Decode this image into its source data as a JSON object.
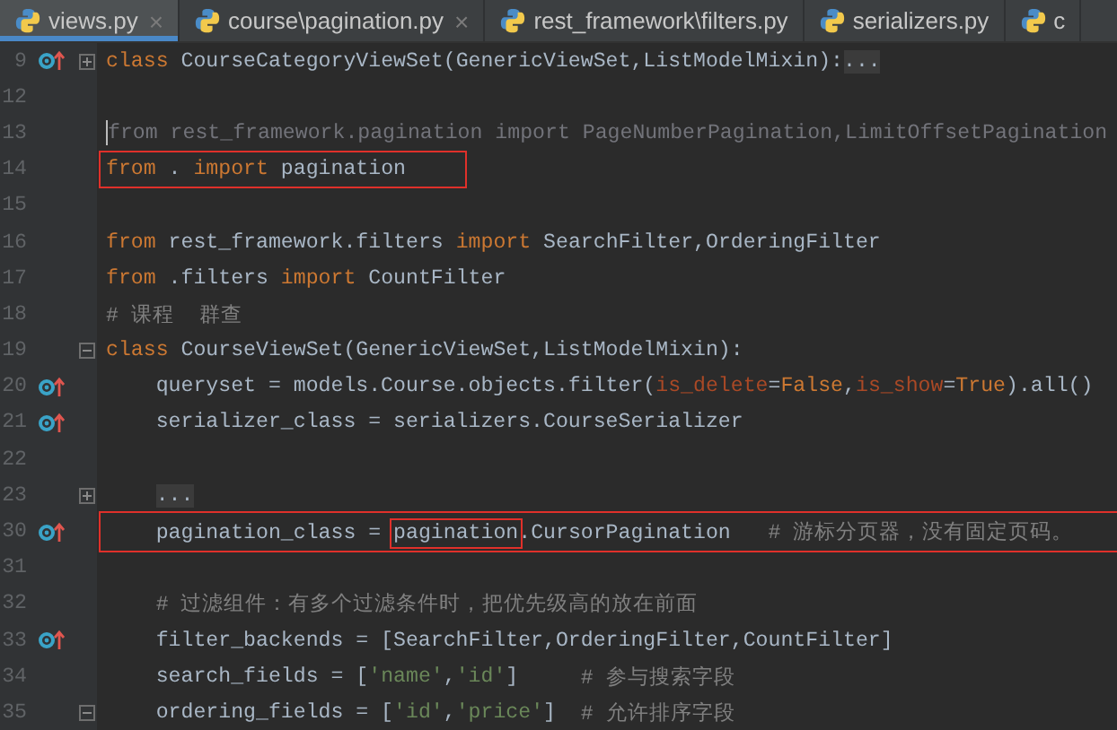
{
  "tabs": [
    {
      "label": "views.py",
      "selected": true,
      "close": "×"
    },
    {
      "label": "course\\pagination.py",
      "selected": false,
      "close": "×"
    },
    {
      "label": "rest_framework\\filters.py",
      "selected": false
    },
    {
      "label": "serializers.py",
      "selected": false
    },
    {
      "label": "c",
      "selected": false
    }
  ],
  "lines": [
    {
      "number": "9",
      "override": true,
      "folded": true,
      "tokens": [
        {
          "kind": "kw",
          "text": "class"
        },
        {
          "kind": "plain",
          "text": " CourseCategoryViewSet(GenericViewSet,ListModelMixin):"
        },
        {
          "kind": "fold",
          "text": "..."
        }
      ]
    },
    {
      "number": "12",
      "override": false
    },
    {
      "number": "13",
      "override": false,
      "caret": true,
      "tokens": [
        {
          "kind": "faded",
          "text": "from rest_framework.pagination import PageNumberPagination,LimitOffsetPagination"
        }
      ]
    },
    {
      "number": "14",
      "override": false,
      "boxed": true,
      "tokens": [
        {
          "kind": "kw",
          "text": "from"
        },
        {
          "kind": "plain",
          "text": " . "
        },
        {
          "kind": "kw",
          "text": "import"
        },
        {
          "kind": "plain",
          "text": " pagination"
        }
      ]
    },
    {
      "number": "15",
      "override": false
    },
    {
      "number": "16",
      "override": false,
      "tokens": [
        {
          "kind": "kw",
          "text": "from"
        },
        {
          "kind": "plain",
          "text": " rest_framework.filters "
        },
        {
          "kind": "kw",
          "text": "import"
        },
        {
          "kind": "plain",
          "text": " SearchFilter,OrderingFilter"
        }
      ]
    },
    {
      "number": "17",
      "override": false,
      "tokens": [
        {
          "kind": "kw",
          "text": "from"
        },
        {
          "kind": "plain",
          "text": " .filters "
        },
        {
          "kind": "kw",
          "text": "import"
        },
        {
          "kind": "plain",
          "text": " CountFilter"
        }
      ]
    },
    {
      "number": "18",
      "override": false,
      "tokens": [
        {
          "kind": "comment",
          "text": "# 课程  群查"
        }
      ]
    },
    {
      "number": "19",
      "override": false,
      "folded": false,
      "tokens": [
        {
          "kind": "kw",
          "text": "class"
        },
        {
          "kind": "plain",
          "text": " CourseViewSet(GenericViewSet,ListModelMixin):"
        }
      ]
    },
    {
      "number": "20",
      "override": true,
      "tokens": [
        {
          "kind": "plain",
          "text": "    queryset = models.Course.objects.filter("
        },
        {
          "kind": "param",
          "text": "is_delete"
        },
        {
          "kind": "plain",
          "text": "="
        },
        {
          "kind": "kw",
          "text": "False"
        },
        {
          "kind": "plain",
          "text": ","
        },
        {
          "kind": "param",
          "text": "is_show"
        },
        {
          "kind": "plain",
          "text": "="
        },
        {
          "kind": "kw",
          "text": "True"
        },
        {
          "kind": "plain",
          "text": ").all()"
        }
      ]
    },
    {
      "number": "21",
      "override": true,
      "tokens": [
        {
          "kind": "plain",
          "text": "    serializer_class = serializers.CourseSerializer"
        }
      ]
    },
    {
      "number": "22",
      "override": false
    },
    {
      "number": "23",
      "override": false,
      "folded": true,
      "indented": true,
      "tokens": [
        {
          "kind": "fold",
          "text": "..."
        }
      ]
    },
    {
      "number": "30",
      "override": true,
      "boxed": true,
      "tokens": [
        {
          "kind": "plain",
          "text": "    pagination_class = "
        },
        {
          "kind": "plain",
          "text": "pagination",
          "boxed": true
        },
        {
          "kind": "plain",
          "text": ".CursorPagination   "
        },
        {
          "kind": "comment",
          "text": "# 游标分页器，没有固定页码。"
        }
      ]
    },
    {
      "number": "31",
      "override": false
    },
    {
      "number": "32",
      "override": false,
      "tokens": [
        {
          "kind": "comment",
          "text": "    # 过滤组件：有多个过滤条件时，把优先级高的放在前面"
        }
      ]
    },
    {
      "number": "33",
      "override": true,
      "tokens": [
        {
          "kind": "plain",
          "text": "    filter_backends = [SearchFilter,OrderingFilter,CountFilter]"
        }
      ]
    },
    {
      "number": "34",
      "override": false,
      "tokens": [
        {
          "kind": "plain",
          "text": "    search_fields = ["
        },
        {
          "kind": "string",
          "text": "'name'"
        },
        {
          "kind": "plain",
          "text": ","
        },
        {
          "kind": "string",
          "text": "'id'"
        },
        {
          "kind": "plain",
          "text": "]     "
        },
        {
          "kind": "comment",
          "text": "# 参与搜索字段"
        }
      ]
    },
    {
      "number": "35",
      "override": false,
      "folded": false,
      "tokens": [
        {
          "kind": "plain",
          "text": "    ordering_fields = ["
        },
        {
          "kind": "string",
          "text": "'id'"
        },
        {
          "kind": "plain",
          "text": ","
        },
        {
          "kind": "string",
          "text": "'price'"
        },
        {
          "kind": "plain",
          "text": "]  "
        },
        {
          "kind": "comment",
          "text": "# 允许排序字段"
        }
      ]
    }
  ]
}
